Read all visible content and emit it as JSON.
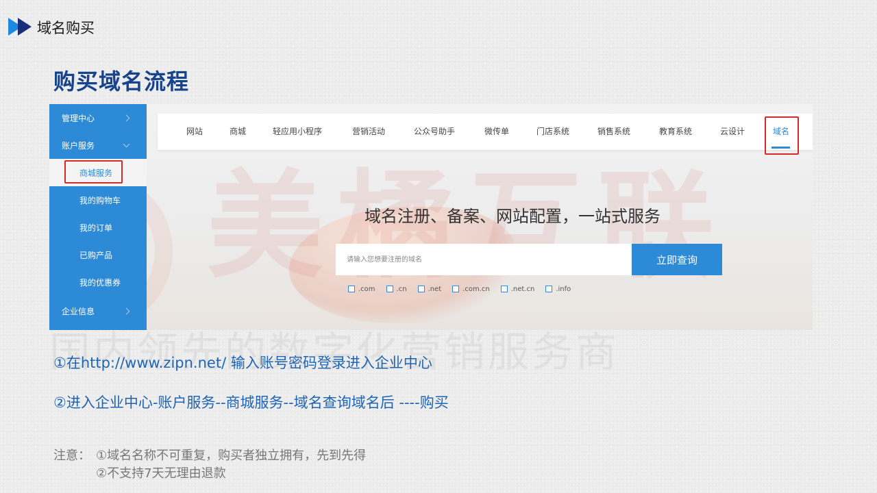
{
  "header": {
    "section_title": "域名购买",
    "icon": "play-arrows-icon"
  },
  "slide_title": "购买域名流程",
  "screenshot": {
    "watermark_text": "美橘互联",
    "slogan_watermark": "国内领先的数字化营销服务商",
    "sidebar": {
      "items": [
        {
          "label": "管理中心",
          "chevron": "right"
        },
        {
          "label": "账户服务",
          "chevron": "down"
        },
        {
          "label": "商城服务",
          "active": true
        },
        {
          "label": "我的购物车"
        },
        {
          "label": "我的订单"
        },
        {
          "label": "已购产品"
        },
        {
          "label": "我的优惠券"
        },
        {
          "label": "企业信息",
          "chevron": "right"
        }
      ]
    },
    "topnav": {
      "items": [
        "网站",
        "商城",
        "轻应用小程序",
        "营销活动",
        "公众号助手",
        "微传单",
        "门店系统",
        "销售系统",
        "教育系统",
        "云设计",
        "域名"
      ],
      "active": "域名"
    },
    "hero_heading": "域名注册、备案、网站配置，一站式服务",
    "search": {
      "placeholder": "请输入您想要注册的域名",
      "button_label": "立即查询"
    },
    "suffixes": [
      ".com",
      ".cn",
      ".net",
      ".com.cn",
      ".net.cn",
      ".info"
    ]
  },
  "steps": [
    "①在http://www.zipn.net/ 输入账号密码登录进入企业中心",
    "②进入企业中心-账户服务--商城服务--域名查询域名后 ----购买"
  ],
  "note": {
    "label": "注意：",
    "lines": [
      "①域名名称不可重复，购买者独立拥有，先到先得",
      "②不支持7天无理由退款"
    ]
  },
  "colors": {
    "accent": "#2d8ad6",
    "title": "#17428c",
    "step_text": "#1e64b4",
    "highlight_box": "#d7282a"
  }
}
